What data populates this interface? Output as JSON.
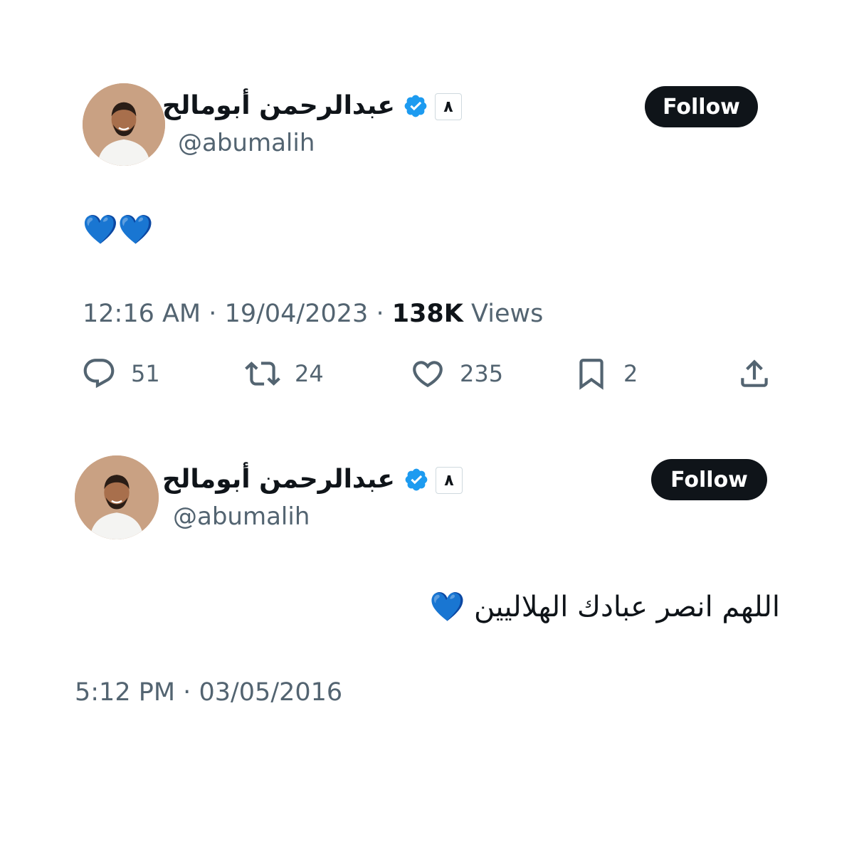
{
  "tweets": [
    {
      "display_name": "عبدالرحمن أبومالح",
      "affiliation_badge": "٨",
      "handle": "@abumalih",
      "follow_label": "Follow",
      "text": "💙💙",
      "time": "12:16 AM",
      "separator": "·",
      "date": "19/04/2023",
      "views_count": "138K",
      "views_label": "Views",
      "actions": {
        "replies": "51",
        "reposts": "24",
        "likes": "235",
        "bookmarks": "2"
      }
    },
    {
      "display_name": "عبدالرحمن أبومالح",
      "affiliation_badge": "٨",
      "handle": "@abumalih",
      "follow_label": "Follow",
      "text": "اللهم انصر عبادك الهلاليين 💙",
      "time": "5:12 PM",
      "separator": "·",
      "date": "03/05/2016"
    }
  ],
  "colors": {
    "verified": "#1d9bf0",
    "follow_bg": "#0f1419",
    "secondary_text": "#536471",
    "heart": "#1e6bf5"
  },
  "icons": [
    "verified-icon",
    "reply-icon",
    "repost-icon",
    "like-icon",
    "bookmark-icon",
    "share-icon"
  ]
}
